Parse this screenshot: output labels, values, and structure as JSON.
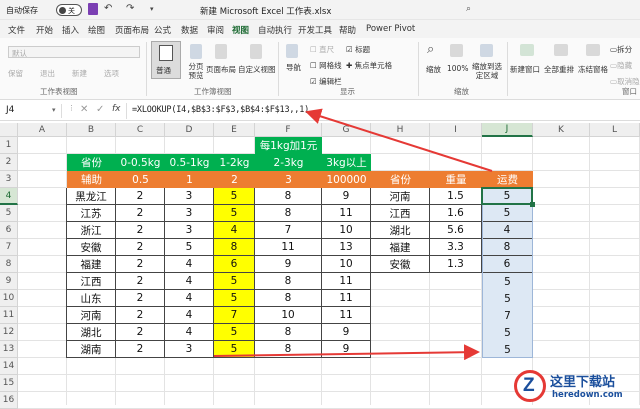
{
  "titlebar": {
    "autosave_label": "自动保存",
    "toggle_state": "关",
    "title": "新建 Microsoft Excel 工作表.xlsx"
  },
  "tabs": [
    "文件",
    "开始",
    "插入",
    "绘图",
    "页面布局",
    "公式",
    "数据",
    "审阅",
    "视图",
    "自动执行",
    "开发工具",
    "帮助",
    "Power Pivot"
  ],
  "active_tab": "视图",
  "ribbon": {
    "default_label": "默认",
    "keep": "保留",
    "exit": "退出",
    "new": "新建",
    "options": "选项",
    "group_sheetview": "工作表视图",
    "normal": "普通",
    "page_break": "分页预览",
    "page_layout": "页面布局",
    "custom_view": "自定义视图",
    "group_workbookview": "工作簿视图",
    "navigation": "导航",
    "ruler": "直尺",
    "gridlines": "网格线",
    "focus_cell": "焦点单元格",
    "headings": "标题",
    "formula_bar": "编辑栏",
    "group_show": "显示",
    "zoom": "缩放",
    "zoom100": "100%",
    "zoom_sel": "缩放到选定区域",
    "group_zoom": "缩放",
    "new_window": "新建窗口",
    "arrange_all": "全部重排",
    "freeze": "冻结窗格",
    "split": "拆分",
    "hide": "隐藏",
    "unhide": "取消隐藏",
    "group_window": "窗口"
  },
  "formula_bar": {
    "name_box": "J4",
    "fx": "fx",
    "formula": "=XLOOKUP(I4,$B$3:$F$3,$B$4:$F$13,,1)"
  },
  "columns": [
    "A",
    "B",
    "C",
    "D",
    "E",
    "F",
    "G",
    "H",
    "I",
    "J",
    "K",
    "L"
  ],
  "rows": [
    "1",
    "2",
    "3",
    "4",
    "5",
    "6",
    "7",
    "8",
    "9",
    "10",
    "11",
    "12",
    "13",
    "14",
    "15",
    "16"
  ],
  "note": "每1kg加1元",
  "table1": {
    "header": [
      "省份",
      "0-0.5kg",
      "0.5-1kg",
      "1-2kg",
      "2-3kg",
      "3kg以上"
    ],
    "aux": [
      "辅助",
      "0.5",
      "1",
      "2",
      "3",
      "100000"
    ],
    "rows": [
      [
        "黑龙江",
        "2",
        "3",
        "5",
        "8",
        "9"
      ],
      [
        "江苏",
        "2",
        "3",
        "5",
        "8",
        "11"
      ],
      [
        "浙江",
        "2",
        "3",
        "4",
        "7",
        "10"
      ],
      [
        "安徽",
        "2",
        "5",
        "8",
        "11",
        "13"
      ],
      [
        "福建",
        "2",
        "4",
        "6",
        "9",
        "10"
      ],
      [
        "江西",
        "2",
        "4",
        "5",
        "8",
        "11"
      ],
      [
        "山东",
        "2",
        "4",
        "5",
        "8",
        "11"
      ],
      [
        "河南",
        "2",
        "4",
        "7",
        "10",
        "11"
      ],
      [
        "湖北",
        "2",
        "4",
        "5",
        "8",
        "9"
      ],
      [
        "湖南",
        "2",
        "3",
        "5",
        "8",
        "9"
      ]
    ]
  },
  "table2": {
    "header": [
      "省份",
      "重量",
      "运费"
    ],
    "rows": [
      [
        "河南",
        "1.5",
        "5"
      ],
      [
        "江西",
        "1.6",
        "5"
      ],
      [
        "湖北",
        "5.6",
        "4"
      ],
      [
        "福建",
        "3.3",
        "8"
      ],
      [
        "安徽",
        "1.3",
        "6"
      ]
    ],
    "extra": [
      "5",
      "5",
      "7",
      "5",
      "5"
    ]
  },
  "watermark": {
    "name": "这里下载站",
    "url": "heredown.com"
  },
  "colors": {
    "green_header": "#00b050",
    "orange": "#ed7d31",
    "yellow": "#ffff00",
    "excel_green": "#217346",
    "arrow_red": "#e53935",
    "light_blue": "#dde8f4"
  }
}
